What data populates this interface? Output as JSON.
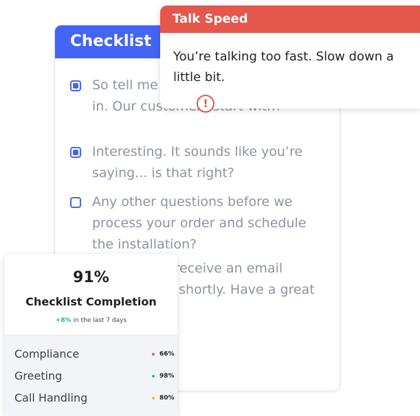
{
  "checklist": {
    "title": "Checklist",
    "items": [
      {
        "text": "So tell me what you're interested in. Our customers start with?",
        "checked": true
      },
      {
        "text": "Interesting. It sounds like you’re saying... is that right?",
        "checked": true
      },
      {
        "text": "Any other questions before we process your order and schedule the installation?",
        "checked": false
      },
      {
        "text": "Great. You'll receive an email confirmation shortly. Have a great day!",
        "checked": false
      }
    ]
  },
  "alert": {
    "title": "Talk Speed",
    "message": "You’re talking too fast. Slow down a little bit.",
    "icon": "exclamation-icon",
    "icon_glyph": "!"
  },
  "stats": {
    "percent": "91%",
    "label": "Checklist Completion",
    "trend_delta": "+8%",
    "trend_text": " in the last 7 days",
    "rows": [
      {
        "name": "Compliance",
        "value": "66%",
        "color": "#e5574b"
      },
      {
        "name": "Greeting",
        "value": "98%",
        "color": "#1fb7a4"
      },
      {
        "name": "Call Handling",
        "value": "80%",
        "color": "#f2b531"
      }
    ]
  },
  "colors": {
    "primary": "#4364f5",
    "alert": "#e5574b"
  }
}
